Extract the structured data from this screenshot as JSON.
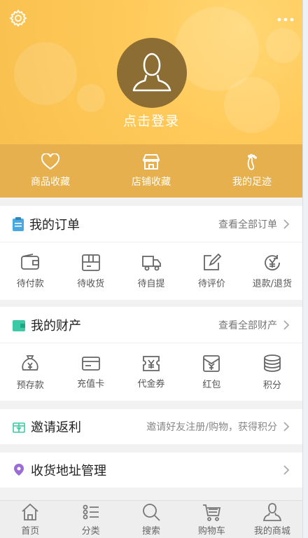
{
  "header": {
    "login_text": "点击登录",
    "favorites": [
      {
        "label": "商品收藏",
        "icon": "heart-icon"
      },
      {
        "label": "店铺收藏",
        "icon": "shop-icon"
      },
      {
        "label": "我的足迹",
        "icon": "footprint-icon"
      }
    ]
  },
  "orders": {
    "title": "我的订单",
    "view_all": "查看全部订单",
    "items": [
      {
        "label": "待付款",
        "icon": "wallet-icon"
      },
      {
        "label": "待收货",
        "icon": "box-icon"
      },
      {
        "label": "待自提",
        "icon": "truck-icon"
      },
      {
        "label": "待评价",
        "icon": "edit-icon"
      },
      {
        "label": "退款/退货",
        "icon": "refund-icon"
      }
    ]
  },
  "assets": {
    "title": "我的财产",
    "view_all": "查看全部财产",
    "items": [
      {
        "label": "预存款",
        "icon": "money-bag-icon"
      },
      {
        "label": "充值卡",
        "icon": "card-icon"
      },
      {
        "label": "代金券",
        "icon": "voucher-icon"
      },
      {
        "label": "红包",
        "icon": "red-envelope-icon"
      },
      {
        "label": "积分",
        "icon": "coins-icon"
      }
    ]
  },
  "invite": {
    "title": "邀请返利",
    "subtitle": "邀请好友注册/购物，获得积分"
  },
  "address": {
    "title": "收货地址管理"
  },
  "tabbar": {
    "items": [
      {
        "label": "首页",
        "icon": "home-icon"
      },
      {
        "label": "分类",
        "icon": "category-icon"
      },
      {
        "label": "搜索",
        "icon": "search-icon"
      },
      {
        "label": "购物车",
        "icon": "cart-icon"
      },
      {
        "label": "我的商城",
        "icon": "user-icon"
      }
    ]
  },
  "colors": {
    "header_bg": "#f8c04e",
    "favbar_bg": "#e5b04d",
    "avatar_bg": "#8c6d34",
    "orders_icon": "#4aa8e0",
    "assets_icon": "#3cc9a5",
    "invite_icon": "#3cc9a5",
    "address_icon": "#9b6bd6"
  }
}
